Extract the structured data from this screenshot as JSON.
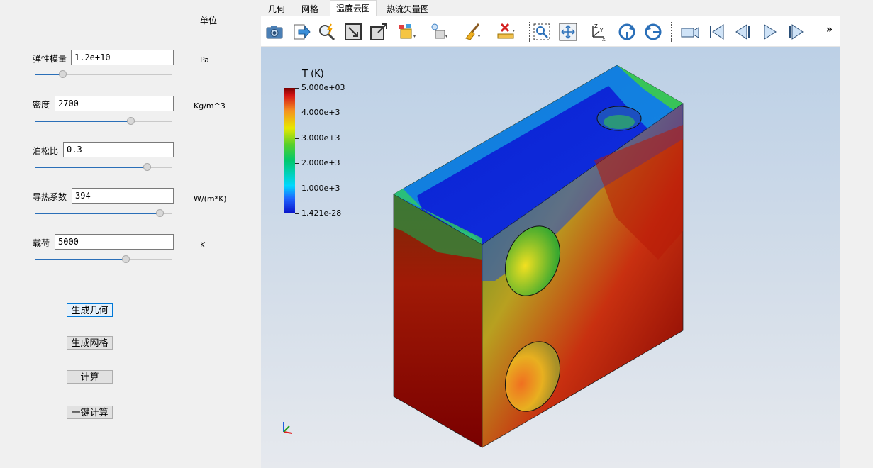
{
  "params": {
    "unit_header": "单位",
    "items": [
      {
        "label": "弹性模量",
        "value": "1.2e+10",
        "unit": "Pa",
        "slider_fraction": 0.2
      },
      {
        "label": "密度",
        "value": "2700",
        "unit": "Kg/m^3",
        "slider_fraction": 0.7
      },
      {
        "label": "泊松比",
        "value": "0.3",
        "unit": "",
        "slider_fraction": 0.82
      },
      {
        "label": "导热系数",
        "value": "394",
        "unit": "W/(m*K)",
        "slider_fraction": 0.91
      },
      {
        "label": "载荷",
        "value": "5000",
        "unit": "K",
        "slider_fraction": 0.66
      }
    ]
  },
  "buttons": {
    "generate_geometry": "生成几何",
    "generate_mesh": "生成网格",
    "compute": "计算",
    "one_click_compute": "一键计算"
  },
  "menu": {
    "items": [
      "几何",
      "网格",
      "温度云图",
      "热流矢量图"
    ],
    "active": "温度云图"
  },
  "toolbar": {
    "icons": [
      "camera-icon",
      "export-arrow-icon",
      "magic-probe-icon",
      "zoom-box-icon",
      "resize-icon",
      "color-cubes-icon",
      "light-cube-icon",
      "broom-icon",
      "delete-ruler-icon",
      "zoom-selection-icon",
      "fit-view-icon",
      "axes-icon",
      "rotate-cw-icon",
      "rotate-ccw-icon",
      "video-camera-icon",
      "first-frame-icon",
      "previous-frame-icon",
      "play-icon",
      "next-frame-icon"
    ],
    "more": "»"
  },
  "colorbar": {
    "title": "T (K)",
    "labels": [
      "5.000e+03",
      "4.000e+3",
      "3.000e+3",
      "2.000e+3",
      "1.000e+3",
      "1.421e-28"
    ],
    "colors": {
      "low": "#0a12c8",
      "mid": "#00c86e",
      "high": "#7a0000"
    }
  },
  "colors": {
    "accent": "#2a6fb8",
    "active_button_border": "#0078d7"
  }
}
